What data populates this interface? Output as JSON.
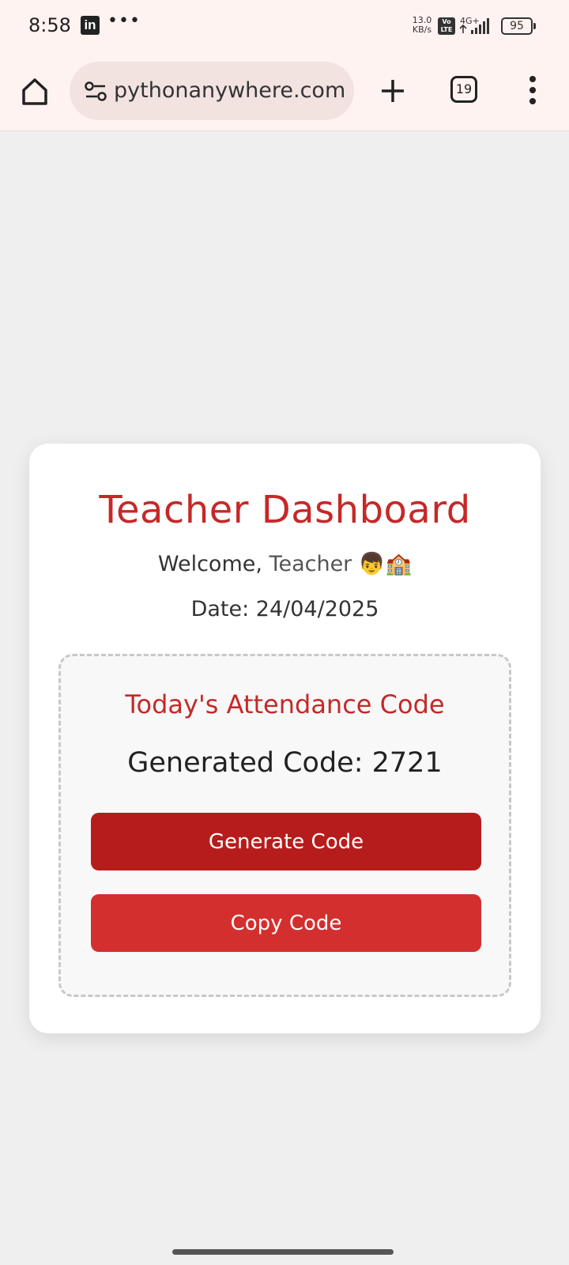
{
  "status_bar": {
    "time": "8:58",
    "notification_icons": [
      "linkedin-icon",
      "more-notifications-icon"
    ],
    "net_speed_value": "13.0",
    "net_speed_unit": "KB/s",
    "volte_label": "Vo LTE",
    "network_type": "4G+",
    "battery_level": "95"
  },
  "browser": {
    "url": "pythonanywhere.com",
    "tab_count": "19",
    "icons": [
      "home-icon",
      "site-info-icon",
      "new-tab-icon",
      "tabs-icon",
      "menu-icon"
    ]
  },
  "dashboard": {
    "title": "Teacher Dashboard",
    "welcome_prefix": "Welcome,",
    "welcome_name": "Teacher",
    "welcome_emoji": [
      "man-face-emoji",
      "school-emoji"
    ],
    "date_label": "Date:",
    "date_value": "24/04/2025",
    "code_section": {
      "heading": "Today's Attendance Code",
      "code_label": "Generated Code:",
      "code_value": "2721",
      "generate_button": "Generate Code",
      "copy_button": "Copy Code"
    }
  },
  "colors": {
    "accent_red": "#c62828",
    "generate_button": "#b71c1c",
    "copy_button": "#d32f2f",
    "browser_bar": "#fff3f1",
    "page_background": "#efefef"
  }
}
